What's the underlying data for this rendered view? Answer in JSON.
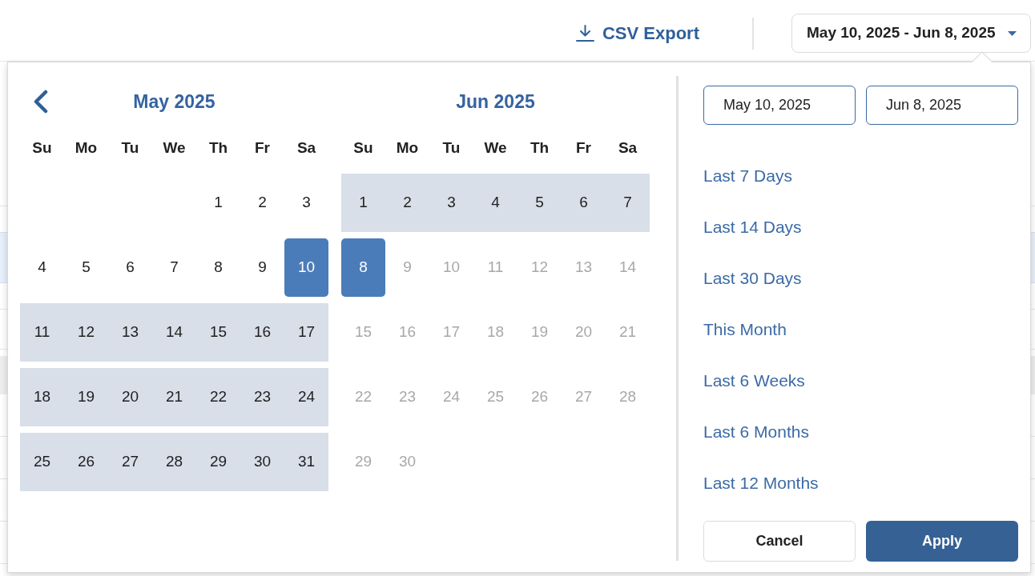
{
  "toolbar": {
    "export_button": {
      "label": "CSV Export"
    },
    "date_range_button": {
      "label": "May 10, 2025 - Jun 8, 2025",
      "expanded": true
    }
  },
  "date_picker": {
    "calendars": [
      {
        "title": "May 2025",
        "show_previous": true,
        "weekdays": [
          "Su",
          "Mo",
          "Tu",
          "We",
          "Th",
          "Fr",
          "Sa"
        ],
        "weeks": [
          {
            "starts_mid_week": true,
            "days": [
              {
                "text": "1",
                "selected": false,
                "in_range": false,
                "disabled": false
              },
              {
                "text": "2",
                "selected": false,
                "in_range": false,
                "disabled": false
              },
              {
                "text": "3",
                "selected": false,
                "in_range": false,
                "disabled": false
              }
            ]
          },
          {
            "days": [
              {
                "text": "4",
                "selected": false,
                "in_range": false,
                "disabled": false
              },
              {
                "text": "5",
                "selected": false,
                "in_range": false,
                "disabled": false
              },
              {
                "text": "6",
                "selected": false,
                "in_range": false,
                "disabled": false
              },
              {
                "text": "7",
                "selected": false,
                "in_range": false,
                "disabled": false
              },
              {
                "text": "8",
                "selected": false,
                "in_range": false,
                "disabled": false
              },
              {
                "text": "9",
                "selected": false,
                "in_range": false,
                "disabled": false
              },
              {
                "text": "10",
                "selected": true,
                "disabled": false
              }
            ]
          },
          {
            "days": [
              {
                "text": "11",
                "selected": false,
                "in_range": true,
                "disabled": false
              },
              {
                "text": "12",
                "selected": false,
                "in_range": true,
                "disabled": false
              },
              {
                "text": "13",
                "selected": false,
                "in_range": true,
                "disabled": false
              },
              {
                "text": "14",
                "selected": false,
                "in_range": true,
                "disabled": false
              },
              {
                "text": "15",
                "selected": false,
                "in_range": true,
                "disabled": false
              },
              {
                "text": "16",
                "selected": false,
                "in_range": true,
                "disabled": false
              },
              {
                "text": "17",
                "selected": false,
                "in_range": true,
                "disabled": false
              }
            ]
          },
          {
            "days": [
              {
                "text": "18",
                "selected": false,
                "in_range": true,
                "disabled": false
              },
              {
                "text": "19",
                "selected": false,
                "in_range": true,
                "disabled": false
              },
              {
                "text": "20",
                "selected": false,
                "in_range": true,
                "disabled": false
              },
              {
                "text": "21",
                "selected": false,
                "in_range": true,
                "disabled": false
              },
              {
                "text": "22",
                "selected": false,
                "in_range": true,
                "disabled": false
              },
              {
                "text": "23",
                "selected": false,
                "in_range": true,
                "disabled": false
              },
              {
                "text": "24",
                "selected": false,
                "in_range": true,
                "disabled": false
              }
            ]
          },
          {
            "days": [
              {
                "text": "25",
                "selected": false,
                "in_range": true,
                "disabled": false
              },
              {
                "text": "26",
                "selected": false,
                "in_range": true,
                "disabled": false
              },
              {
                "text": "27",
                "selected": false,
                "in_range": true,
                "disabled": false
              },
              {
                "text": "28",
                "selected": false,
                "in_range": true,
                "disabled": false
              },
              {
                "text": "29",
                "selected": false,
                "in_range": true,
                "disabled": false
              },
              {
                "text": "30",
                "selected": false,
                "in_range": true,
                "disabled": false
              },
              {
                "text": "31",
                "selected": false,
                "in_range": true,
                "disabled": false
              }
            ]
          }
        ]
      },
      {
        "title": "Jun 2025",
        "weekdays": [
          "Su",
          "Mo",
          "Tu",
          "We",
          "Th",
          "Fr",
          "Sa"
        ],
        "weeks": [
          {
            "days": [
              {
                "text": "1",
                "selected": false,
                "in_range": true,
                "disabled": false
              },
              {
                "text": "2",
                "selected": false,
                "in_range": true,
                "disabled": false
              },
              {
                "text": "3",
                "selected": false,
                "in_range": true,
                "disabled": false
              },
              {
                "text": "4",
                "selected": false,
                "in_range": true,
                "disabled": false
              },
              {
                "text": "5",
                "selected": false,
                "in_range": true,
                "disabled": false
              },
              {
                "text": "6",
                "selected": false,
                "in_range": true,
                "disabled": false
              },
              {
                "text": "7",
                "selected": false,
                "in_range": true,
                "disabled": false
              }
            ]
          },
          {
            "days": [
              {
                "text": "8",
                "selected": true,
                "disabled": false
              },
              {
                "text": "9",
                "selected": false,
                "in_range": false,
                "disabled": true
              },
              {
                "text": "10",
                "selected": false,
                "in_range": false,
                "disabled": true
              },
              {
                "text": "11",
                "selected": false,
                "in_range": false,
                "disabled": true
              },
              {
                "text": "12",
                "selected": false,
                "in_range": false,
                "disabled": true
              },
              {
                "text": "13",
                "selected": false,
                "in_range": false,
                "disabled": true
              },
              {
                "text": "14",
                "selected": false,
                "in_range": false,
                "disabled": true
              }
            ]
          },
          {
            "days": [
              {
                "text": "15",
                "selected": false,
                "in_range": false,
                "disabled": true
              },
              {
                "text": "16",
                "selected": false,
                "in_range": false,
                "disabled": true
              },
              {
                "text": "17",
                "selected": false,
                "in_range": false,
                "disabled": true
              },
              {
                "text": "18",
                "selected": false,
                "in_range": false,
                "disabled": true
              },
              {
                "text": "19",
                "selected": false,
                "in_range": false,
                "disabled": true
              },
              {
                "text": "20",
                "selected": false,
                "in_range": false,
                "disabled": true
              },
              {
                "text": "21",
                "selected": false,
                "in_range": false,
                "disabled": true
              }
            ]
          },
          {
            "days": [
              {
                "text": "22",
                "selected": false,
                "in_range": false,
                "disabled": true
              },
              {
                "text": "23",
                "selected": false,
                "in_range": false,
                "disabled": true
              },
              {
                "text": "24",
                "selected": false,
                "in_range": false,
                "disabled": true
              },
              {
                "text": "25",
                "selected": false,
                "in_range": false,
                "disabled": true
              },
              {
                "text": "26",
                "selected": false,
                "in_range": false,
                "disabled": true
              },
              {
                "text": "27",
                "selected": false,
                "in_range": false,
                "disabled": true
              },
              {
                "text": "28",
                "selected": false,
                "in_range": false,
                "disabled": true
              }
            ]
          },
          {
            "days": [
              {
                "text": "29",
                "selected": false,
                "in_range": false,
                "disabled": true
              },
              {
                "text": "30",
                "selected": false,
                "in_range": false,
                "disabled": true
              }
            ]
          }
        ]
      }
    ],
    "start_field": {
      "value": "May 10, 2025"
    },
    "end_field": {
      "value": "Jun 8, 2025"
    },
    "presets": [
      {
        "label": "Last 7 Days"
      },
      {
        "label": "Last 14 Days"
      },
      {
        "label": "Last 30 Days"
      },
      {
        "label": "This Month"
      },
      {
        "label": "Last 6 Weeks"
      },
      {
        "label": "Last 6 Months"
      },
      {
        "label": "Last 12 Months"
      }
    ],
    "buttons": [
      {
        "label": "Cancel",
        "kind": "secondary"
      },
      {
        "label": "Apply",
        "kind": "primary"
      }
    ]
  }
}
